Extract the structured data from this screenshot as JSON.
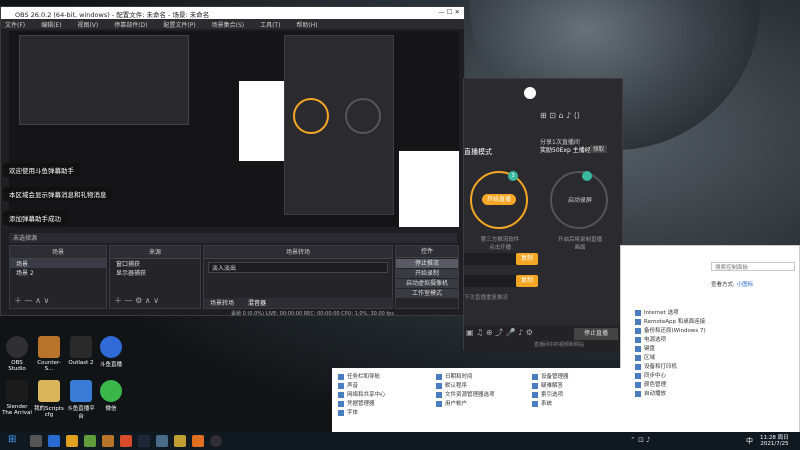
{
  "obs": {
    "title": "OBS 26.0.2 (64-bit, windows) - 配置文件: 未命名 - 场景: 未命名",
    "menu": [
      "文件(F)",
      "编辑(E)",
      "视图(V)",
      "停靠部件(D)",
      "配置文件(P)",
      "场景集合(S)",
      "工具(T)",
      "帮助(H)"
    ],
    "docks": {
      "scenes": "场景",
      "sources": "来源",
      "mixer": "混音器",
      "transitions": "场景转场",
      "controls": "控件"
    },
    "scenes": [
      "场景",
      "场景 2"
    ],
    "sources": [
      "窗口捕获",
      "显示器捕获"
    ],
    "transition": "淡入淡出",
    "controls": [
      "停止推流",
      "开始录制",
      "启动虚拟摄像机",
      "工作室模式",
      "设置",
      "退出"
    ],
    "tabs": [
      "场景转场",
      "混音器"
    ],
    "status": "丢帧 0 (0.0%)  LIVE: 00:00:00  REC: 00:00:00  CPU: 1.0%, 30.00 fps",
    "no_source": "未选择源"
  },
  "chat": {
    "lines": [
      "欢迎使用斗鱼弹幕助手",
      "本区域会显示弹幕消息和礼物消息",
      "添加弹幕助手成功"
    ]
  },
  "live": {
    "notice": "分享1次直播间",
    "notice2": "奖励50Exp 主播经验",
    "notice_btn": "领取",
    "mode": "直播模式",
    "start_btn": "开始直播",
    "start_hint": "第三方推流软件\n点击开播",
    "record_btn": "启动录屏",
    "record_hint": "开启后将录制直播\n画面",
    "set_label": "设置",
    "copy": "复制",
    "footer": "直播间中的视频和网站",
    "bottom_icons": [
      "直播间",
      "房间",
      "截屏",
      "分享",
      "麦克风",
      "声音",
      "设置"
    ],
    "stop_btn": "停止直播",
    "tip": "下次直播重复推流",
    "count": "3"
  },
  "control_panel": {
    "search_placeholder": "搜索控制面板",
    "view": "查看方式:",
    "view_mode": "小图标",
    "items_right": [
      "Internet 选项",
      "RemoteApp 和桌面连接",
      "备份和还原(Windows 7)",
      "电源选项",
      "键盘",
      "区域",
      "设备和打印机",
      "同步中心",
      "颜色管理",
      "自动播放"
    ],
    "items_bottom": [
      "任务栏和导航",
      "日期和时间",
      "设备管理器",
      "声音",
      "默认程序",
      "疑难解答",
      "网络和共享中心",
      "文件资源管理器选项",
      "索引选项",
      "系统",
      "用户帐户",
      "凭据管理器",
      "字体"
    ]
  },
  "desktop_icons": [
    {
      "label": "OBS Studio",
      "color": "#302f33"
    },
    {
      "label": "Counter-S...",
      "color": "#b8742b"
    },
    {
      "label": "Outlast 2",
      "color": "#2a2a2a"
    },
    {
      "label": "斗鱼直播",
      "color": "#2f6ad6"
    },
    {
      "label": "Slender The Arrival",
      "color": "#1b1b1b"
    },
    {
      "label": "我的Scripts cfg",
      "color": "#d9b65c"
    },
    {
      "label": "斗鱼直播平台",
      "color": "#3a7bd5"
    },
    {
      "label": "微信",
      "color": "#3bb64a"
    }
  ],
  "taskbar": {
    "time": "11:28 周日",
    "date": "2021/7/25",
    "lang": "中"
  }
}
